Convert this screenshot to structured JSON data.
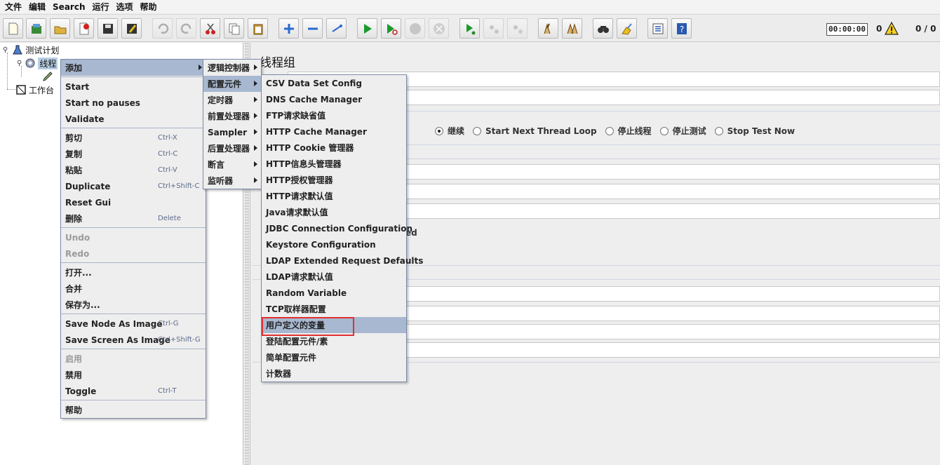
{
  "menubar": [
    "文件",
    "编辑",
    "Search",
    "运行",
    "选项",
    "帮助"
  ],
  "toolbar": {
    "timer": "00:00:00",
    "error_count": "0",
    "thread_count": "0 / 0",
    "icons": [
      "new-icon",
      "templates-icon",
      "open-icon",
      "close-icon",
      "save-icon",
      "save-as-icon",
      "undo-icon",
      "redo-icon",
      "cut-icon",
      "copy-icon",
      "paste-icon",
      "expand-icon",
      "collapse-icon",
      "toggle-icon",
      "start-icon",
      "start-no-pauses-icon",
      "stop-icon",
      "shutdown-icon",
      "remote-start-icon",
      "remote-stop-icon",
      "remote-exit-icon",
      "clear-icon",
      "clear-all-icon",
      "search-icon",
      "reset-search-icon",
      "function-helper-icon",
      "help-icon"
    ]
  },
  "tree": {
    "test_plan": "测试计划",
    "thread_group": "线程",
    "workbench": "工作台"
  },
  "right_panel": {
    "title": "线程组",
    "radio_options": [
      "继续",
      "Start Next Thread Loop",
      "停止线程",
      "停止测试",
      "Stop Test Now"
    ],
    "selected_radio": 0,
    "partial_text": "ed"
  },
  "context_menu": [
    {
      "label": "添加",
      "submenu": true,
      "highlight": true
    },
    {
      "sep": true
    },
    {
      "label": "Start"
    },
    {
      "label": "Start no pauses"
    },
    {
      "label": "Validate"
    },
    {
      "sep": true
    },
    {
      "label": "剪切",
      "accel": "Ctrl-X"
    },
    {
      "label": "复制",
      "accel": "Ctrl-C"
    },
    {
      "label": "粘贴",
      "accel": "Ctrl-V"
    },
    {
      "label": "Duplicate",
      "accel": "Ctrl+Shift-C"
    },
    {
      "label": "Reset Gui"
    },
    {
      "label": "删除",
      "accel": "Delete"
    },
    {
      "sep": true
    },
    {
      "label": "Undo",
      "disabled": true
    },
    {
      "label": "Redo",
      "disabled": true
    },
    {
      "sep": true
    },
    {
      "label": "打开..."
    },
    {
      "label": "合并"
    },
    {
      "label": "保存为..."
    },
    {
      "sep": true
    },
    {
      "label": "Save Node As Image",
      "accel": "Ctrl-G"
    },
    {
      "label": "Save Screen As Image",
      "accel": "Ctrl+Shift-G"
    },
    {
      "sep": true
    },
    {
      "label": "启用",
      "disabled": true
    },
    {
      "label": "禁用"
    },
    {
      "label": "Toggle",
      "accel": "Ctrl-T"
    },
    {
      "sep": true
    },
    {
      "label": "帮助"
    }
  ],
  "add_submenu": [
    {
      "label": "逻辑控制器",
      "submenu": true
    },
    {
      "label": "配置元件",
      "submenu": true,
      "highlight": true
    },
    {
      "label": "定时器",
      "submenu": true
    },
    {
      "label": "前置处理器",
      "submenu": true
    },
    {
      "label": "Sampler",
      "submenu": true
    },
    {
      "label": "后置处理器",
      "submenu": true
    },
    {
      "label": "断言",
      "submenu": true
    },
    {
      "label": "监听器",
      "submenu": true
    }
  ],
  "config_submenu": [
    {
      "label": "CSV Data Set Config"
    },
    {
      "label": "DNS Cache Manager"
    },
    {
      "label": "FTP请求缺省值"
    },
    {
      "label": "HTTP Cache Manager"
    },
    {
      "label": "HTTP Cookie 管理器"
    },
    {
      "label": "HTTP信息头管理器"
    },
    {
      "label": "HTTP授权管理器"
    },
    {
      "label": "HTTP请求默认值"
    },
    {
      "label": "Java请求默认值"
    },
    {
      "label": "JDBC Connection Configuration"
    },
    {
      "label": "Keystore Configuration"
    },
    {
      "label": "LDAP Extended Request Defaults"
    },
    {
      "label": "LDAP请求默认值"
    },
    {
      "label": "Random Variable"
    },
    {
      "label": "TCP取样器配置"
    },
    {
      "label": "用户定义的变量",
      "highlight": true
    },
    {
      "label": "登陆配置元件/素"
    },
    {
      "label": "简单配置元件"
    },
    {
      "label": "计数器"
    }
  ]
}
